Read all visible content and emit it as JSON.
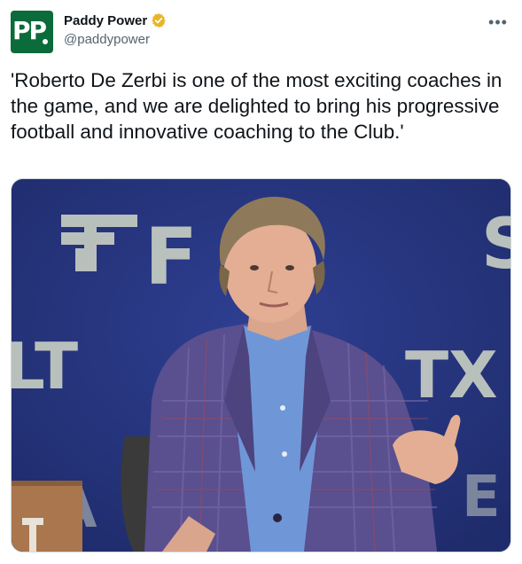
{
  "author": {
    "display_name": "Paddy Power",
    "handle": "@paddypower",
    "avatar_text": "PP",
    "verified": true,
    "avatar_color": "#0b6b3a",
    "verified_color": "#e9b628"
  },
  "tweet": {
    "text": "'Roberto De Zerbi is one of the most exciting coaches in the game, and we are delighted to bring his progressive football and innovative coaching to the Club.'"
  },
  "media": {
    "type": "photo",
    "background_letters": [
      "FTX",
      "S",
      "LT",
      "TX",
      "T"
    ]
  },
  "icons": {
    "more": "more-options-icon",
    "verified": "verified-badge-icon"
  }
}
